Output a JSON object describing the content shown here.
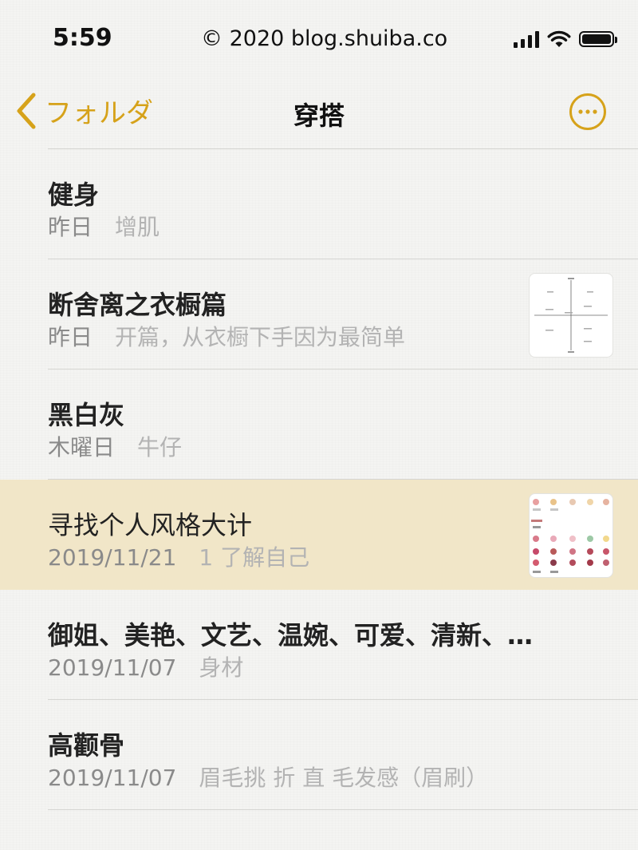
{
  "status_bar": {
    "time": "5:59",
    "copyright": "© 2020 blog.shuiba.co",
    "icons": [
      "signal-icon",
      "wifi-icon",
      "battery-icon"
    ]
  },
  "nav": {
    "back_label": "フォルダ",
    "title": "穿搭",
    "icons": [
      "chevron-left-icon",
      "more-icon"
    ]
  },
  "notes": [
    {
      "title": "健身",
      "date": "昨日",
      "preview": "增肌"
    },
    {
      "title": "断舍离之衣橱篇",
      "date": "昨日",
      "preview": "开篇，从衣橱下手因为最简单",
      "thumbnail": "quadrant-diagram-thumbnail"
    },
    {
      "title": "黑白灰",
      "date": "木曜日",
      "preview": "牛仔"
    },
    {
      "title": "寻找个人风格大计",
      "date": "2019/11/21",
      "preview": "1 了解自己",
      "thumbnail": "color-palette-thumbnail",
      "selected": true
    },
    {
      "title": "御姐、美艳、文艺、温婉、可爱、清新、…",
      "date": "2019/11/07",
      "preview": "身材"
    },
    {
      "title": "高颧骨",
      "date": "2019/11/07",
      "preview": "眉毛挑 折 直 毛发感（眉刷）"
    }
  ],
  "colors": {
    "accent": "#d6a21a",
    "selected_row": "#f1e6c8",
    "date_text": "#8a8a8a",
    "preview_text": "#b3b3b3"
  }
}
